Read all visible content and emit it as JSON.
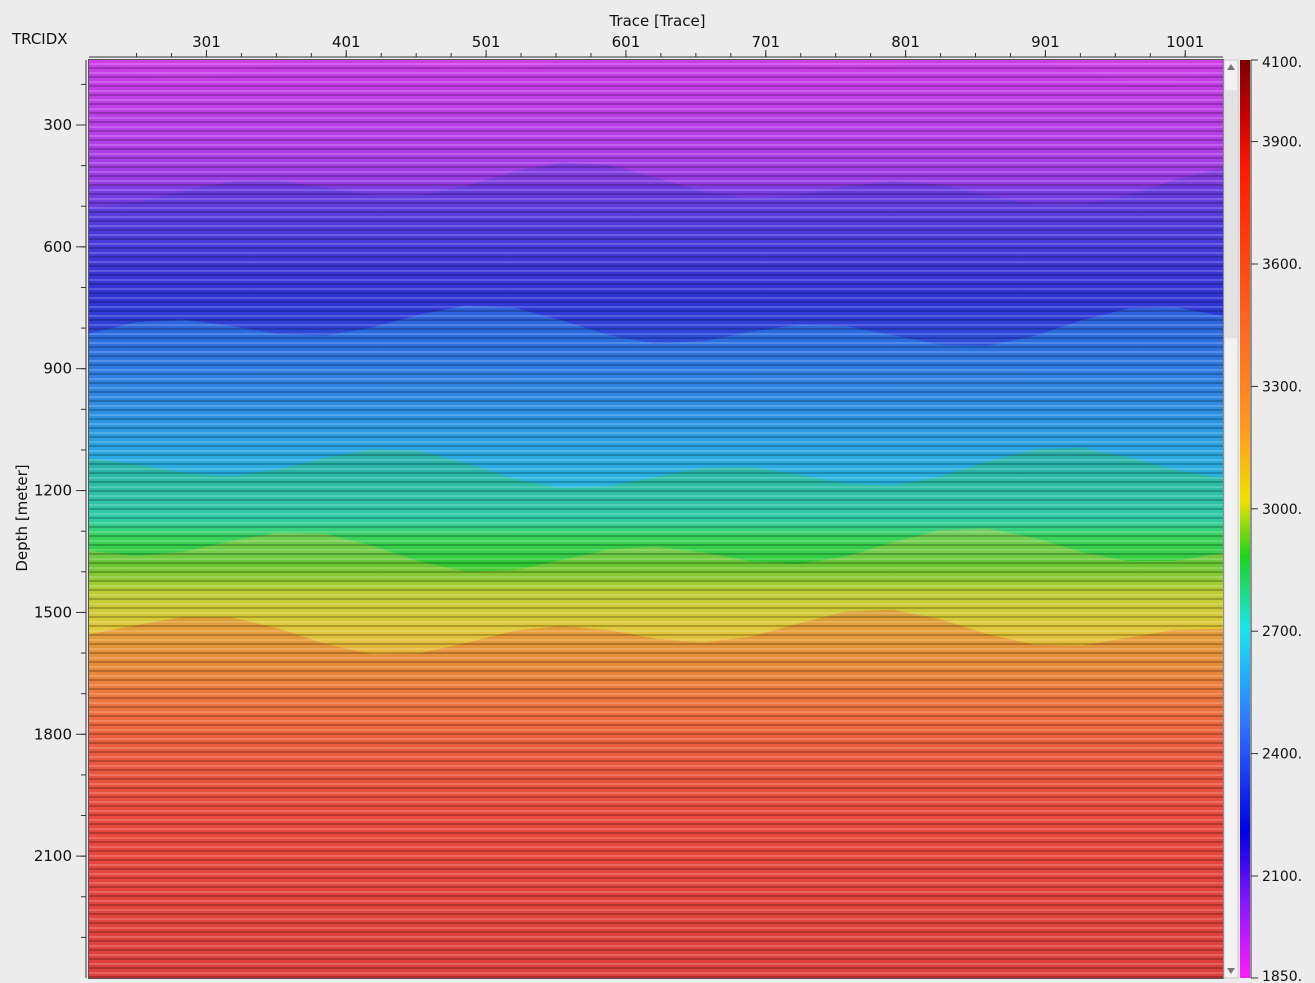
{
  "chart_data": {
    "type": "heatmap",
    "title": "",
    "top_axis_label": "Trace [Trace]",
    "corner_label": "TRCIDX",
    "ylabel": "Depth [meter]",
    "x_ticks": [
      "301",
      "401",
      "501",
      "601",
      "701",
      "801",
      "901",
      "1001"
    ],
    "x_tick_values": [
      301,
      401,
      501,
      601,
      701,
      801,
      901,
      1001
    ],
    "xlim": [
      217,
      1028
    ],
    "y_ticks": [
      "300",
      "600",
      "900",
      "1200",
      "1500",
      "1800",
      "2100"
    ],
    "y_tick_values": [
      300,
      600,
      900,
      1200,
      1500,
      1800,
      2100
    ],
    "ylim": [
      140,
      2400
    ],
    "colorbar": {
      "labels": [
        "4100.",
        "3900.",
        "3600.",
        "3300.",
        "3000.",
        "2700.",
        "2400.",
        "2100.",
        "1850."
      ],
      "values": [
        4100,
        3900,
        3600,
        3300,
        3000,
        2700,
        2400,
        2100,
        1850
      ],
      "range": [
        1850,
        4100
      ],
      "colors": [
        "#8b0000",
        "#ff1a00",
        "#ff6a28",
        "#ff9a1e",
        "#e8e800",
        "#1ed21e",
        "#18e6ee",
        "#3278ff",
        "#0000e6",
        "#8a18ff",
        "#ff1eff"
      ]
    },
    "velocity_layers": [
      {
        "depth_range": [
          140,
          450
        ],
        "value": 1950,
        "color": "#c23ce6"
      },
      {
        "depth_range": [
          450,
          800
        ],
        "value": 2250,
        "color": "#3a3ad8"
      },
      {
        "depth_range": [
          800,
          1150
        ],
        "value": 2650,
        "color": "#2ab4e6"
      },
      {
        "depth_range": [
          1150,
          1350
        ],
        "value": 2950,
        "color": "#2ec82e"
      },
      {
        "depth_range": [
          1350,
          1550
        ],
        "value": 3150,
        "color": "#e6c83a"
      },
      {
        "depth_range": [
          1550,
          2400
        ],
        "value": 3650,
        "color": "#e8463a"
      }
    ]
  }
}
